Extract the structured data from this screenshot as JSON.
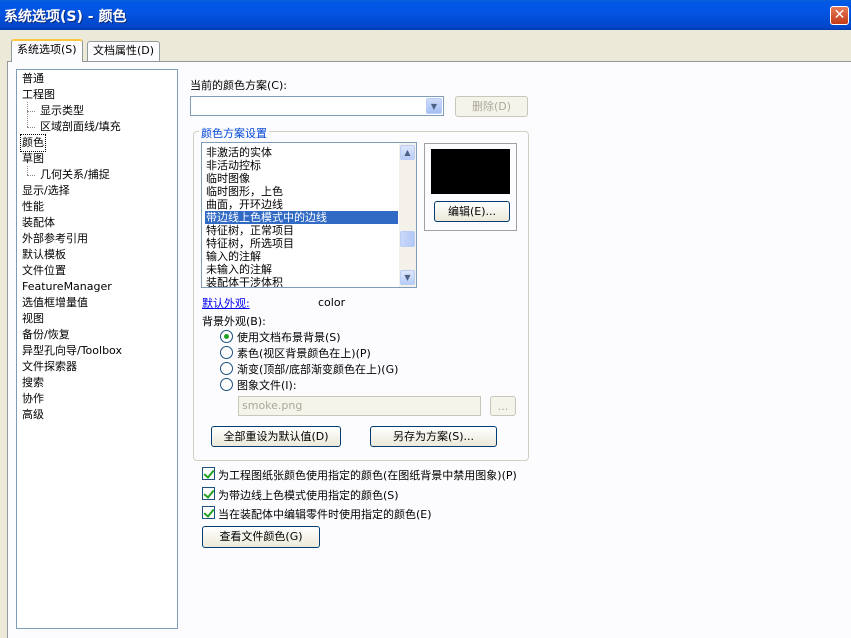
{
  "window": {
    "title": "系统选项(S) - 颜色",
    "close_glyph": "✕"
  },
  "tabs": [
    {
      "label": "系统选项(S)",
      "active": true
    },
    {
      "label": "文档属性(D)",
      "active": false
    }
  ],
  "tree": {
    "items": [
      {
        "label": "普通"
      },
      {
        "label": "工程图"
      },
      {
        "label": "显示类型"
      },
      {
        "label": "区域剖面线/填充"
      },
      {
        "label": "颜色",
        "selected": true
      },
      {
        "label": "草图"
      },
      {
        "label": "几何关系/捕捉"
      },
      {
        "label": "显示/选择"
      },
      {
        "label": "性能"
      },
      {
        "label": "装配体"
      },
      {
        "label": "外部参考引用"
      },
      {
        "label": "默认模板"
      },
      {
        "label": "文件位置"
      },
      {
        "label": "FeatureManager"
      },
      {
        "label": "选值框增量值"
      },
      {
        "label": "视图"
      },
      {
        "label": "备份/恢复"
      },
      {
        "label": "异型孔向导/Toolbox"
      },
      {
        "label": "文件探索器"
      },
      {
        "label": "搜索"
      },
      {
        "label": "协作"
      },
      {
        "label": "高级"
      }
    ]
  },
  "scheme": {
    "label": "当前的颜色方案(C):",
    "value": "",
    "delete_button": "删除(D)"
  },
  "settings": {
    "group_title": "颜色方案设置",
    "list_items": [
      {
        "label": "非激活的实体"
      },
      {
        "label": "非活动控标"
      },
      {
        "label": "临时图像"
      },
      {
        "label": "临时图形，上色"
      },
      {
        "label": "曲面，开环边线"
      },
      {
        "label": "带边线上色模式中的边线",
        "selected": true
      },
      {
        "label": "特征树，正常项目"
      },
      {
        "label": "特征树，所选项目"
      },
      {
        "label": "输入的注解"
      },
      {
        "label": "未输入的注解"
      },
      {
        "label": "装配体干涉体积"
      }
    ],
    "swatch_color": "#000000",
    "edit_button": "编辑(E)...",
    "default_appearance_link": "默认外观:",
    "default_appearance_value": "color",
    "background_label": "背景外观(B):",
    "radios": [
      {
        "label": "使用文档布景背景(S)",
        "checked": true
      },
      {
        "label": "素色(视区背景颜色在上)(P)",
        "checked": false
      },
      {
        "label": "渐变(顶部/底部渐变颜色在上)(G)",
        "checked": false
      },
      {
        "label": "图象文件(I):",
        "checked": false
      }
    ],
    "image_file_value": "smoke.png",
    "browse_button": "...",
    "reset_button": "全部重设为默认值(D)",
    "save_as_button": "另存为方案(S)..."
  },
  "checkboxes": [
    {
      "label": "为工程图纸张颜色使用指定的颜色(在图纸背景中禁用图象)(P)",
      "checked": true
    },
    {
      "label": "为带边线上色模式使用指定的颜色(S)",
      "checked": true
    },
    {
      "label": "当在装配体中编辑零件时使用指定的颜色(E)",
      "checked": true
    }
  ],
  "view_doc_colors_button": "查看文件颜色(G)",
  "colors": {
    "titlebar": "#0554e3",
    "selection": "#316ac5",
    "group_title": "#0046d5"
  }
}
